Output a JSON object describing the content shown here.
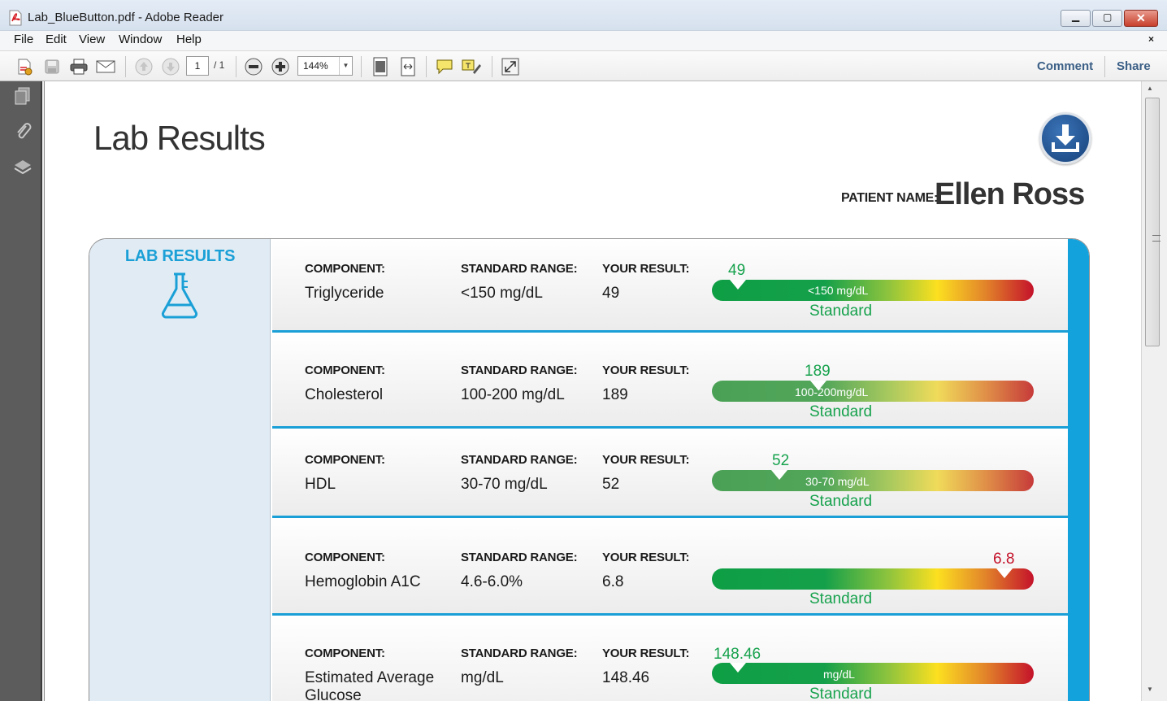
{
  "window": {
    "title": "Lab_BlueButton.pdf - Adobe Reader",
    "close_glyph": "✕",
    "min_glyph": "▁",
    "max_glyph": "▢"
  },
  "menu": {
    "items": [
      "File",
      "Edit",
      "View",
      "Window",
      "Help"
    ],
    "close_glyph": "×"
  },
  "toolbar": {
    "page_current": "1",
    "page_total": "/ 1",
    "zoom": "144%",
    "zoom_arrow": "▼",
    "comment": "Comment",
    "share": "Share"
  },
  "scrollbar": {
    "up": "▲",
    "down": "▼"
  },
  "document": {
    "page_title": "Lab Results",
    "patient_label": "PATIENT NAME:",
    "patient_name": "Ellen Ross",
    "card_title": "LAB RESULTS",
    "column_labels": {
      "component": "COMPONENT:",
      "range": "STANDARD RANGE:",
      "result": "YOUR RESULT:"
    },
    "rows": [
      {
        "component": "Triglyceride",
        "range": "<150 mg/dL",
        "result": "49",
        "bar_label": "<150 mg/dL",
        "marker": "49",
        "status": "Standard",
        "level": 0.08
      },
      {
        "component": "Cholesterol",
        "range": "100-200 mg/dL",
        "result": "189",
        "bar_label": "100-200mg/dL",
        "marker": "189",
        "status": "Standard",
        "level": 0.33
      },
      {
        "component": "HDL",
        "range": "30-70 mg/dL",
        "result": "52",
        "bar_label": "30-70 mg/dL",
        "marker": "52",
        "status": "Standard",
        "level": 0.21
      },
      {
        "component": "Hemoglobin A1C",
        "range": "4.6-6.0%",
        "result": "6.8",
        "bar_label": "",
        "marker": "6.8",
        "status": "Standard",
        "level": 0.91
      },
      {
        "component": "Estimated Average Glucose",
        "range": "mg/dL",
        "result": "148.46",
        "bar_label": "mg/dL",
        "marker": "148.46",
        "status": "Standard",
        "level": 0.08
      }
    ]
  },
  "colors": {
    "accent_blue": "#1aa0d6",
    "status_green": "#17a24d",
    "status_red": "#c4122a"
  }
}
